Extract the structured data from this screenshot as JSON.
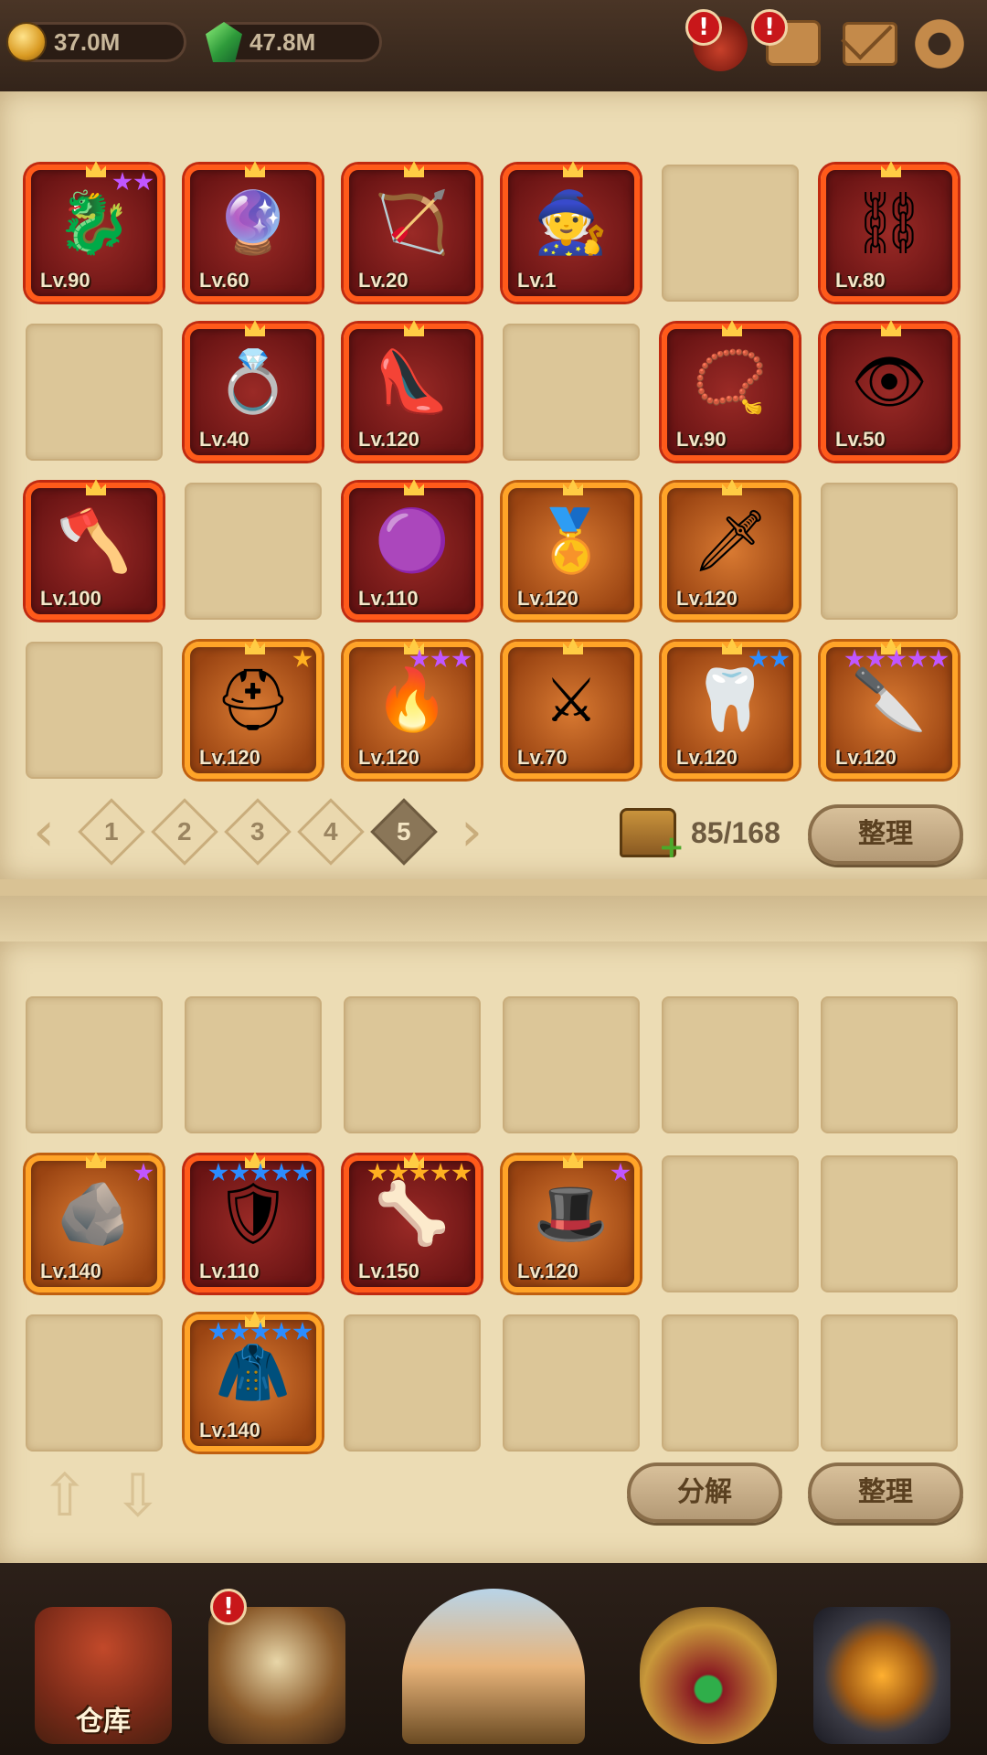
{
  "currency": {
    "gold": "37.0M",
    "gems": "47.8M"
  },
  "topbar_icons": [
    "potion-icon",
    "chat-icon",
    "mail-icon",
    "gear-icon"
  ],
  "inventory_top": [
    {
      "lvl": "Lv.90",
      "rarity": "red",
      "icon": "🐉",
      "stars": 2,
      "star_color": "purple"
    },
    {
      "lvl": "Lv.60",
      "rarity": "red",
      "icon": "🔮",
      "stars": 0
    },
    {
      "lvl": "Lv.20",
      "rarity": "red",
      "icon": "🏹",
      "stars": 0
    },
    {
      "lvl": "Lv.1",
      "rarity": "red",
      "icon": "🧙",
      "stars": 0
    },
    {
      "empty": true
    },
    {
      "lvl": "Lv.80",
      "rarity": "red",
      "icon": "⛓",
      "stars": 0
    },
    {
      "empty": true
    },
    {
      "lvl": "Lv.40",
      "rarity": "red",
      "icon": "💍",
      "stars": 0
    },
    {
      "lvl": "Lv.120",
      "rarity": "red",
      "icon": "👠",
      "stars": 0
    },
    {
      "empty": true
    },
    {
      "lvl": "Lv.90",
      "rarity": "red",
      "icon": "📿",
      "stars": 0
    },
    {
      "lvl": "Lv.50",
      "rarity": "red",
      "icon": "👁",
      "stars": 0
    },
    {
      "lvl": "Lv.100",
      "rarity": "red",
      "icon": "🪓",
      "stars": 0
    },
    {
      "empty": true
    },
    {
      "lvl": "Lv.110",
      "rarity": "red",
      "icon": "🟣",
      "stars": 0
    },
    {
      "lvl": "Lv.120",
      "rarity": "orange",
      "icon": "🏅",
      "stars": 0
    },
    {
      "lvl": "Lv.120",
      "rarity": "orange",
      "icon": "🗡",
      "stars": 0
    },
    {
      "empty": true
    },
    {
      "empty": true
    },
    {
      "lvl": "Lv.120",
      "rarity": "orange",
      "icon": "⛑",
      "stars": 1,
      "star_color": "gold"
    },
    {
      "lvl": "Lv.120",
      "rarity": "orange",
      "icon": "🔥",
      "stars": 3,
      "star_color": "purple"
    },
    {
      "lvl": "Lv.70",
      "rarity": "orange",
      "icon": "⚔",
      "stars": 0
    },
    {
      "lvl": "Lv.120",
      "rarity": "orange",
      "icon": "🦷",
      "stars": 2,
      "star_color": "blue"
    },
    {
      "lvl": "Lv.120",
      "rarity": "orange",
      "icon": "🔪",
      "stars": 5,
      "star_color": "purple"
    }
  ],
  "pagination": {
    "pages": [
      "1",
      "2",
      "3",
      "4",
      "5"
    ],
    "active": "5"
  },
  "capacity": "85/168",
  "sort_label": "整理",
  "inventory_bottom": [
    {
      "empty": true
    },
    {
      "empty": true
    },
    {
      "empty": true
    },
    {
      "empty": true
    },
    {
      "empty": true
    },
    {
      "empty": true
    },
    {
      "lvl": "Lv.140",
      "rarity": "orange",
      "icon": "🪨",
      "stars": 1,
      "star_color": "purple"
    },
    {
      "lvl": "Lv.110",
      "rarity": "red",
      "icon": "🛡",
      "stars": 5,
      "star_color": "blue"
    },
    {
      "lvl": "Lv.150",
      "rarity": "red",
      "icon": "🦴",
      "stars": 5,
      "star_color": "gold"
    },
    {
      "lvl": "Lv.120",
      "rarity": "orange",
      "icon": "🎩",
      "stars": 1,
      "star_color": "purple"
    },
    {
      "empty": true
    },
    {
      "empty": true
    },
    {
      "empty": true
    },
    {
      "lvl": "Lv.140",
      "rarity": "orange",
      "icon": "🧥",
      "stars": 5,
      "star_color": "blue"
    },
    {
      "empty": true
    },
    {
      "empty": true
    },
    {
      "empty": true
    },
    {
      "empty": true
    }
  ],
  "bottom_buttons": {
    "disassemble": "分解",
    "sort": "整理"
  },
  "nav": [
    {
      "name": "warehouse",
      "label": "仓库"
    },
    {
      "name": "tavern",
      "label": ""
    },
    {
      "name": "portal",
      "label": ""
    },
    {
      "name": "treasure",
      "label": ""
    },
    {
      "name": "forge",
      "label": ""
    }
  ],
  "alert_symbol": "!"
}
